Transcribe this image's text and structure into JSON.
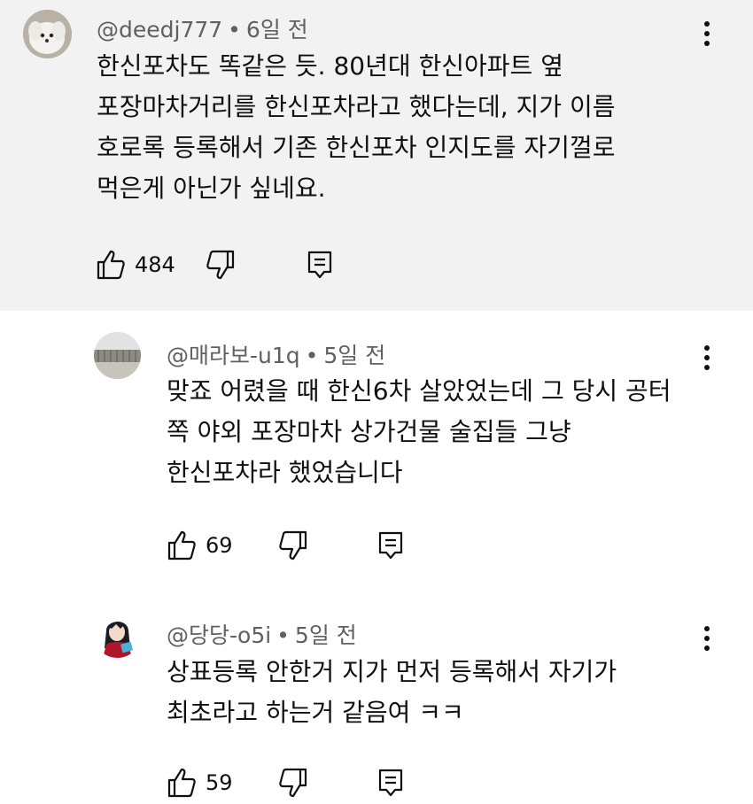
{
  "comments": [
    {
      "author": "@deedj777",
      "time": "6일 전",
      "separator": "•",
      "lines": [
        "한신포차도 똑같은 듯. 80년대 한신아파트 옆",
        "포장마차거리를 한신포차라고 했다는데, 지가 이름",
        "호로록 등록해서 기존 한신포차 인지도를 자기껄로",
        "먹은게 아닌가 싶네요."
      ],
      "likes": "484"
    },
    {
      "author": "@매라보-u1q",
      "time": "5일 전",
      "separator": "•",
      "lines": [
        "맞죠 어렸을 때 한신6차 살았었는데 그 당시 공터",
        "쪽 야외 포장마차 상가건물 술집들 그냥",
        "한신포차라 했었습니다"
      ],
      "likes": "69"
    },
    {
      "author": "@당당-o5i",
      "time": "5일 전",
      "separator": "•",
      "lines": [
        "상표등록 안한거 지가 먼저 등록해서 자기가",
        "최초라고 하는거 같음여 ㅋㅋ"
      ],
      "likes": "59"
    }
  ]
}
